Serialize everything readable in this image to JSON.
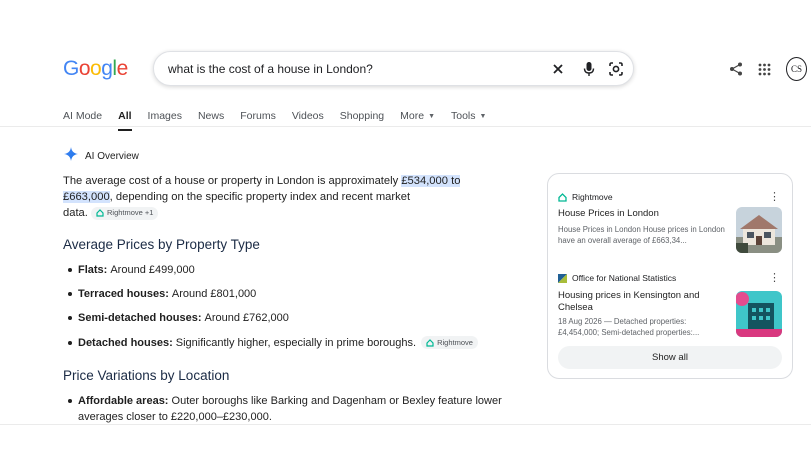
{
  "logo": {
    "letters": [
      "G",
      "o",
      "o",
      "g",
      "l",
      "e"
    ],
    "colors": [
      "#4285F4",
      "#EA4335",
      "#FBBC05",
      "#4285F4",
      "#34A853",
      "#EA4335"
    ]
  },
  "search": {
    "query": "what is the cost of a house in London?"
  },
  "header_icons": [
    "share-icon",
    "apps-grid-icon"
  ],
  "avatar": {
    "initials": "CS"
  },
  "tabs": [
    {
      "label": "AI Mode",
      "active": false
    },
    {
      "label": "All",
      "active": true
    },
    {
      "label": "Images",
      "active": false
    },
    {
      "label": "News",
      "active": false
    },
    {
      "label": "Forums",
      "active": false
    },
    {
      "label": "Videos",
      "active": false
    },
    {
      "label": "Shopping",
      "active": false
    },
    {
      "label": "More",
      "active": false,
      "dropdown": true
    },
    {
      "label": "Tools",
      "active": false,
      "dropdown": true
    }
  ],
  "ai_overview": {
    "label": "AI Overview",
    "intro_before": "The average cost of a house or property in London is approximately ",
    "intro_highlight_1": "£534,000 to",
    "intro_highlight_2": "£663,000",
    "intro_after": ", depending on the specific property index and recent market",
    "intro_end": "data.",
    "intro_chip": "Rightmove +1",
    "section1_title": "Average Prices by Property Type",
    "bullets": [
      {
        "term": "Flats:",
        "text": "Around £499,000"
      },
      {
        "term": "Terraced houses:",
        "text": "Around £801,000"
      },
      {
        "term": "Semi-detached houses:",
        "text": "Around £762,000"
      },
      {
        "term": "Detached houses:",
        "text": "Significantly higher, especially in prime boroughs.",
        "chip": "Rightmove"
      }
    ],
    "section2_title": "Price Variations by Location",
    "bullets2": [
      {
        "term": "Affordable areas:",
        "text": "Outer boroughs like Barking and Dagenham or Bexley feature lower",
        "text2": "averages closer to £220,000–£230,000."
      }
    ]
  },
  "sources": [
    {
      "site": "Rightmove",
      "title": "House Prices in London",
      "snippet": "House Prices in London House prices in London have an overall average of £663,34..."
    },
    {
      "site": "Office for National Statistics",
      "title": "Housing prices in Kensington and Chelsea",
      "snippet": "18 Aug 2026 — Detached properties: £4,454,000; Semi-detached properties:..."
    }
  ],
  "show_all_label": "Show all",
  "colors": {
    "accent": "#1a73e8",
    "highlight": "#d3e3fd",
    "rightmove": "#00DEB6"
  }
}
